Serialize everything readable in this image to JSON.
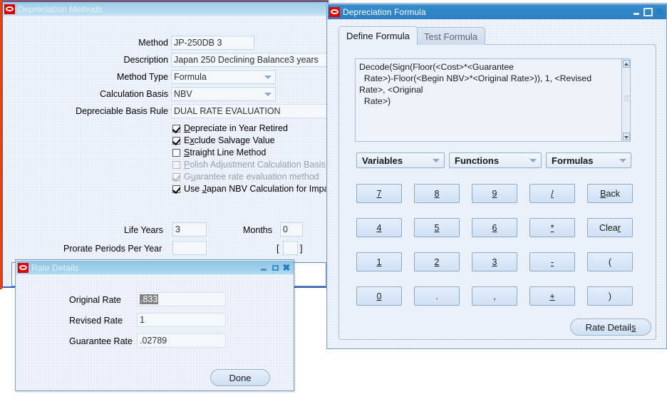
{
  "main_window": {
    "title": "Depreciation Methods",
    "logo": "oracle-logo-icon",
    "fields": [
      {
        "label": "Method",
        "value": "JP-250DB 3",
        "type": "text"
      },
      {
        "label": "Description",
        "value": "Japan 250 Declining Balance3 years",
        "type": "text"
      },
      {
        "label": "Method Type",
        "value": "Formula",
        "type": "poplist"
      },
      {
        "label": "Calculation Basis",
        "value": "NBV",
        "type": "poplist"
      },
      {
        "label": "Depreciable Basis Rule",
        "value": "DUAL RATE EVALUATION",
        "type": "text"
      }
    ],
    "checkboxes": [
      {
        "label": "Depreciate in Year Retired",
        "mnemonic": "D",
        "checked": true,
        "enabled": true
      },
      {
        "label": "Exclude Salvage Value",
        "mnemonic": "x",
        "checked": true,
        "enabled": true
      },
      {
        "label": "Straight Line Method",
        "mnemonic": "S",
        "checked": false,
        "enabled": true
      },
      {
        "label": "Polish Adjustment Calculation Basis",
        "mnemonic": "P",
        "checked": false,
        "enabled": false
      },
      {
        "label": "Guarantee rate evaluation method",
        "mnemonic": "u",
        "checked": true,
        "enabled": false
      },
      {
        "label": "Use Japan NBV Calculation for Impa",
        "mnemonic": "J",
        "checked": true,
        "enabled": true
      }
    ],
    "life_years_label": "Life Years",
    "life_years_value": "3",
    "months_label": "Months",
    "months_value": "0",
    "prorate_label": "Prorate Periods Per Year",
    "prorate_value": "",
    "bracket_open": "[",
    "bracket_value": "",
    "bracket_close": "]"
  },
  "formula_window": {
    "title": "Depreciation Formula",
    "logo": "oracle-logo-icon",
    "window_buttons": [
      "minimize-icon",
      "maximize-icon",
      "close-icon"
    ],
    "tabs": [
      {
        "label": "Define Formula",
        "selected": true
      },
      {
        "label": "Test Formula",
        "selected": false
      }
    ],
    "formula_text": "Decode(Sign(Floor(<Cost>*<Guarantee\n  Rate>)-Floor(<Begin NBV>*<Original Rate>)), 1, <Revised\nRate>, <Original\n  Rate>)",
    "dropdowns": [
      {
        "label": "Variables"
      },
      {
        "label": "Functions"
      },
      {
        "label": "Formulas"
      }
    ],
    "keypad": [
      [
        {
          "label": "7",
          "mnemonic": "7"
        },
        {
          "label": "8",
          "mnemonic": "8"
        },
        {
          "label": "9",
          "mnemonic": "9"
        },
        {
          "label": "/",
          "mnemonic": "/"
        },
        {
          "label": "Back",
          "mnemonic": "B"
        }
      ],
      [
        {
          "label": "4",
          "mnemonic": "4"
        },
        {
          "label": "5",
          "mnemonic": "5"
        },
        {
          "label": "6",
          "mnemonic": "6"
        },
        {
          "label": "*",
          "mnemonic": "*"
        },
        {
          "label": "Clear",
          "mnemonic": "r"
        }
      ],
      [
        {
          "label": "1",
          "mnemonic": "1"
        },
        {
          "label": "2",
          "mnemonic": "2"
        },
        {
          "label": "3",
          "mnemonic": "3"
        },
        {
          "label": "-",
          "mnemonic": "-"
        },
        {
          "label": "(",
          "mnemonic": ""
        }
      ],
      [
        {
          "label": "0",
          "mnemonic": "0"
        },
        {
          "label": ".",
          "mnemonic": ""
        },
        {
          "label": ",",
          "mnemonic": ""
        },
        {
          "label": "+",
          "mnemonic": "+"
        },
        {
          "label": ")",
          "mnemonic": ""
        }
      ]
    ],
    "rate_details_button": "Rate Details",
    "rate_details_mnemonic": "s"
  },
  "rate_details_window": {
    "title": "Rate Details",
    "logo": "oracle-logo-icon",
    "window_buttons": [
      "minimize-icon",
      "maximize-icon",
      "close-icon"
    ],
    "fields": [
      {
        "label": "Original Rate",
        "value": ".833",
        "selected": true
      },
      {
        "label": "Revised Rate",
        "value": "1",
        "selected": false
      },
      {
        "label": "Guarantee Rate",
        "value": ".02789",
        "selected": false
      }
    ],
    "done_button": "Done"
  },
  "colors": {
    "titlebar_active": "#2f86c8",
    "titlebar_inactive": "#aad4ec",
    "oracle_red": "#e00000",
    "pane_bg": "#eef2fa",
    "field_bg": "#f4f8fd",
    "border": "#93aec8",
    "outer_border": "#f04000",
    "selection": "#808080"
  }
}
